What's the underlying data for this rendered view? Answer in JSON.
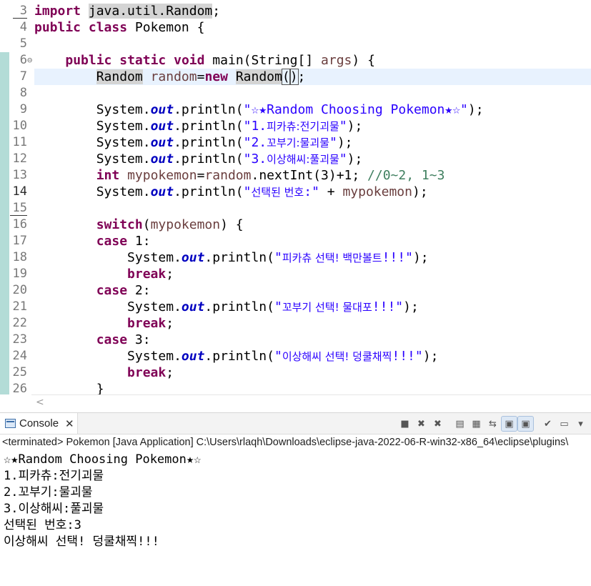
{
  "editor": {
    "lines": [
      {
        "n": "3",
        "html": "<span class='kw'>import</span> <span class='occ'>java.util.Random</span>;"
      },
      {
        "n": "4",
        "html": "<span class='kw'>public</span> <span class='kw'>class</span> Pokemon {"
      },
      {
        "n": "5",
        "html": ""
      },
      {
        "n": "6",
        "html": "    <span class='kw'>public</span> <span class='kw'>static</span> <span class='kw'>void</span> main(String[] <span class='var'>args</span>) {"
      },
      {
        "n": "7",
        "html": "        <span class='occ'>Random</span> <span class='var'>random</span>=<span class='kw'>new</span> <span class='occ'>Random</span><span class='box'>(</span><span class='caret'></span><span class='box'>)</span>;"
      },
      {
        "n": "8",
        "html": ""
      },
      {
        "n": "9",
        "html": "        System.<span class='fld'>out</span>.println(<span class='str'>\"☆★Random Choosing Pokemon★☆\"</span>);"
      },
      {
        "n": "10",
        "html": "        System.<span class='fld'>out</span>.println(<span class='str'>\"1.<span class='kr'>피카츄:전기괴물</span>\"</span>);"
      },
      {
        "n": "11",
        "html": "        System.<span class='fld'>out</span>.println(<span class='str'>\"2.<span class='kr'>꼬부기:물괴물</span>\"</span>);"
      },
      {
        "n": "12",
        "html": "        System.<span class='fld'>out</span>.println(<span class='str'>\"3.<span class='kr'>이상해씨:풀괴물</span>\"</span>);"
      },
      {
        "n": "13",
        "html": "        <span class='kw'>int</span> <span class='var'>mypokemon</span>=<span class='var'>random</span>.nextInt(3)+1; <span class='cmt'>//0~2, 1~3</span>"
      },
      {
        "n": "14",
        "html": "        System.<span class='fld'>out</span>.println(<span class='str'>\"<span class='kr'>선택된 번호</span>:\"</span> + <span class='var'>mypokemon</span>);"
      },
      {
        "n": "15",
        "html": ""
      },
      {
        "n": "16",
        "html": "        <span class='kw'>switch</span>(<span class='var'>mypokemon</span>) {"
      },
      {
        "n": "17",
        "html": "        <span class='kw'>case</span> 1:"
      },
      {
        "n": "18",
        "html": "            System.<span class='fld'>out</span>.println(<span class='str'>\"<span class='kr'>피카츄 선택! 백만볼트</span>!!!\"</span>);"
      },
      {
        "n": "19",
        "html": "            <span class='kw'>break</span>;"
      },
      {
        "n": "20",
        "html": "        <span class='kw'>case</span> 2:"
      },
      {
        "n": "21",
        "html": "            System.<span class='fld'>out</span>.println(<span class='str'>\"<span class='kr'>꼬부기 선택! 물대포</span>!!!\"</span>);"
      },
      {
        "n": "22",
        "html": "            <span class='kw'>break</span>;"
      },
      {
        "n": "23",
        "html": "        <span class='kw'>case</span> 3:"
      },
      {
        "n": "24",
        "html": "            System.<span class='fld'>out</span>.println(<span class='str'>\"<span class='kr'>이상해씨 선택! 덩쿨채찍</span>!!!\"</span>);"
      },
      {
        "n": "25",
        "html": "            <span class='kw'>break</span>;"
      },
      {
        "n": "26",
        "html": "        }"
      }
    ],
    "scroll_left_arrow": "<"
  },
  "console": {
    "tab_label": "Console",
    "tab_close": "✕",
    "status_line": "<terminated> Pokemon [Java Application] C:\\Users\\rlaqh\\Downloads\\eclipse-java-2022-06-R-win32-x86_64\\eclipse\\plugins\\",
    "output": [
      "☆★Random Choosing Pokemon★☆",
      "1.피카츄:전기괴물",
      "2.꼬부기:물괴물",
      "3.이상해씨:풀괴물",
      "선택된 번호:3",
      "이상해씨 선택! 덩쿨채찍!!!"
    ],
    "toolbar": [
      {
        "name": "terminate-icon",
        "glyph": "■",
        "pressed": false
      },
      {
        "name": "remove-launch-icon",
        "glyph": "✖",
        "pressed": false
      },
      {
        "name": "remove-all-terminated-icon",
        "glyph": "✖",
        "pressed": false
      },
      {
        "name": "sep",
        "glyph": "",
        "pressed": false
      },
      {
        "name": "clear-console-icon",
        "glyph": "▤",
        "pressed": false
      },
      {
        "name": "scroll-lock-icon",
        "glyph": "▦",
        "pressed": false
      },
      {
        "name": "word-wrap-icon",
        "glyph": "⇆",
        "pressed": false
      },
      {
        "name": "show-on-stdout-icon",
        "glyph": "▣",
        "pressed": true
      },
      {
        "name": "show-on-stderr-icon",
        "glyph": "▣",
        "pressed": true
      },
      {
        "name": "sep",
        "glyph": "",
        "pressed": false
      },
      {
        "name": "pin-console-icon",
        "glyph": "✔",
        "pressed": false
      },
      {
        "name": "display-selected-console-icon",
        "glyph": "▭",
        "pressed": false
      },
      {
        "name": "dropdown-icon",
        "glyph": "▾",
        "pressed": false
      }
    ]
  },
  "colors": {
    "keyword": "#7f0055",
    "string": "#2a00ff",
    "field": "#0000c0",
    "comment": "#3f7f5f",
    "current_line": "#e8f2fe",
    "change_ruler": "#b3dcd7"
  }
}
